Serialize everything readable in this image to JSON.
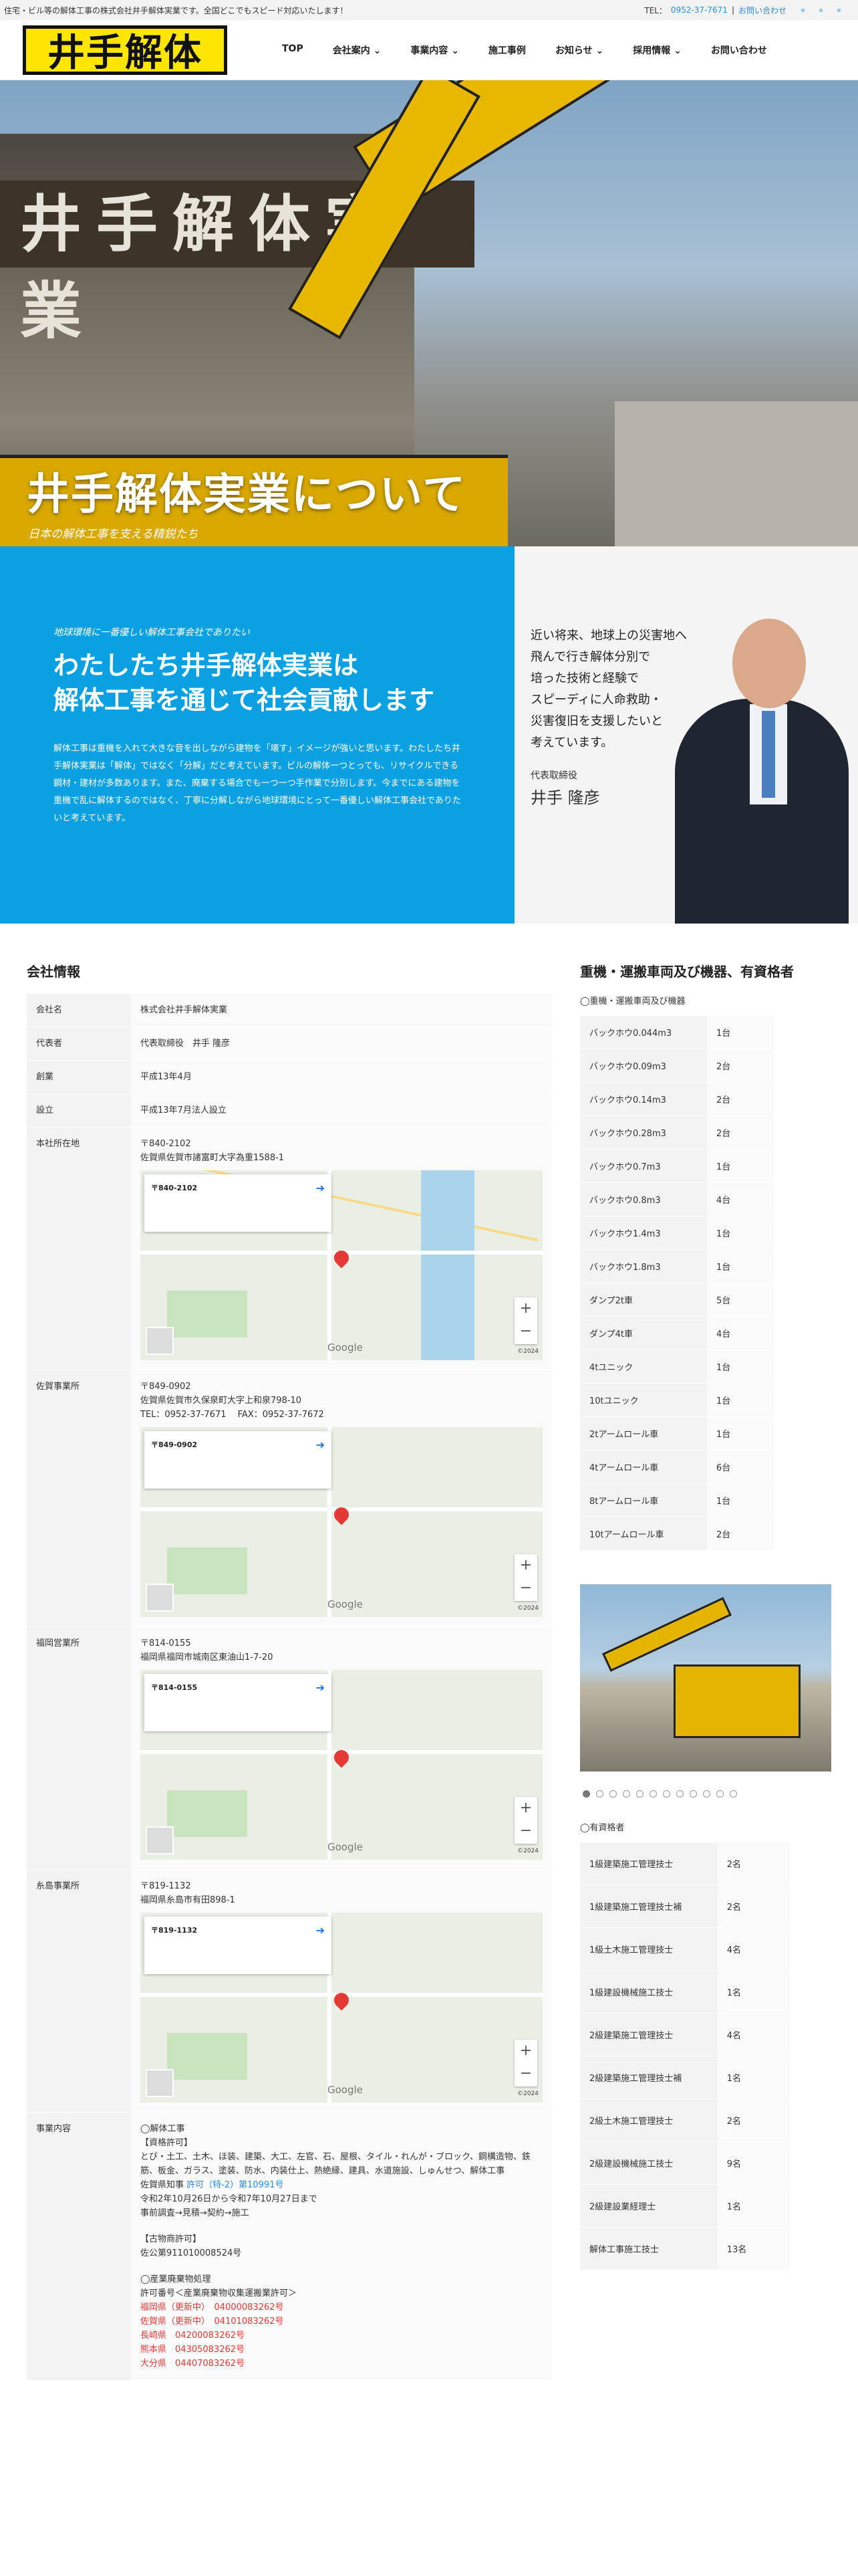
{
  "topbar": {
    "text": "住宅・ビル等の解体工事の株式会社井手解体実業です。全国どこでもスピード対応いたします！",
    "tel_label": "TEL：",
    "tel": "0952-37-7671",
    "sep": "|",
    "contact": "お問い合わせ"
  },
  "header": {
    "logo": "井手解体",
    "nav": [
      "TOP",
      "会社案内",
      "事業内容",
      "施工事例",
      "お知らせ",
      "採用情報",
      "お問い合わせ"
    ]
  },
  "hero": {
    "sign": "井手解体実業",
    "title": "井手解体実業について",
    "subtitle": "日本の解体工事を支える精鋭たち"
  },
  "about": {
    "tag": "地球環境に一番優しい解体工事会社でありたい",
    "headline1": "わたしたち井手解体実業は",
    "headline2": "解体工事を通じて社会貢献します",
    "body": "解体工事は重機を入れて大きな音を出しながら建物を「壊す」イメージが強いと思います。わたしたち井手解体実業は「解体」ではなく「分解」だと考えています。ビルの解体一つとっても、リサイクルできる鋼材・建材が多数あります。また、廃棄する場合でも一つ一つ手作業で分別します。今までにある建物を重機で乱に解体するのではなく、丁寧に分解しながら地球環境にとって一番優しい解体工事会社でありたいと考えています。",
    "message": [
      "近い将来、地球上の災害地へ",
      "飛んで行き解体分別で",
      "培った技術と経験で",
      "スピーディに人命救助・",
      "災害復旧を支援したいと",
      "考えています。"
    ],
    "role": "代表取締役",
    "name": "井手 隆彦"
  },
  "company": {
    "title": "会社情報",
    "rows": [
      {
        "k": "会社名",
        "v": "株式会社井手解体実業"
      },
      {
        "k": "代表者",
        "v": "代表取締役　井手 隆彦"
      },
      {
        "k": "創業",
        "v": "平成13年4月"
      },
      {
        "k": "設立",
        "v": "平成13年7月法人設立"
      }
    ],
    "hq": {
      "k": "本社所在地",
      "zip": "〒840-2102",
      "addr": "佐賀県佐賀市諸富町大字為重1588-1",
      "card": "〒840-2102"
    },
    "saga": {
      "k": "佐賀事業所",
      "zip": "〒849-0902",
      "addr": "佐賀県佐賀市久保泉町大字上和泉798-10",
      "tel": "TEL：0952-37-7671　 FAX：0952-37-7672",
      "card": "〒849-0902"
    },
    "fukuoka": {
      "k": "福岡営業所",
      "zip": "〒814-0155",
      "addr": "福岡県福岡市城南区東油山1-7-20",
      "card": "〒814-0155"
    },
    "itoshima": {
      "k": "糸島事業所",
      "zip": "〒819-1132",
      "addr": "福岡県糸島市有田898-1",
      "card": "〒819-1132"
    },
    "map_terms": "©2024",
    "business": {
      "k": "事業内容",
      "lines": [
        "◯解体工事",
        "【資格許可】",
        "とび・土工、土木、ほ装、建築、大工、左官、石、屋根、タイル・れんが・ブロック、鋼構造物、鉄筋、板金、ガラス、塗装、防水、内装仕上、熱絶縁、建具、水道施設、しゅんせつ、解体工事"
      ],
      "license_pre": "佐賀県知事",
      "license_link": "許可（特-2）第10991号",
      "license_dates": "令和2年10月26日から令和7年10月27日まで",
      "flow": "事前調査→見積→契約→施工",
      "antique_title": "【古物商許可】",
      "antique": "佐公第911010008524号",
      "waste_title": "◯産業廃棄物処理",
      "waste_sub": "許可番号＜産業廃棄物収集運搬業許可＞",
      "waste": [
        {
          "pref": "福岡県（更新中）",
          "no": "04000083262号"
        },
        {
          "pref": "佐賀県（更新中）",
          "no": "04101083262号"
        },
        {
          "pref": "長崎県",
          "no": "04200083262号"
        },
        {
          "pref": "熊本県",
          "no": "04305083262号"
        },
        {
          "pref": "大分県",
          "no": "04407083262号"
        }
      ]
    }
  },
  "machines": {
    "title": "重機・運搬車両及び機器、有資格者",
    "subtitle": "◯重機・運搬車両及び機器",
    "rows": [
      {
        "k": "バックホウ0.044m3",
        "v": "1台"
      },
      {
        "k": "バックホウ0.09m3",
        "v": "2台"
      },
      {
        "k": "バックホウ0.14m3",
        "v": "2台"
      },
      {
        "k": "バックホウ0.28m3",
        "v": "2台"
      },
      {
        "k": "バックホウ0.7m3",
        "v": "1台"
      },
      {
        "k": "バックホウ0.8m3",
        "v": "4台"
      },
      {
        "k": "バックホウ1.4m3",
        "v": "1台"
      },
      {
        "k": "バックホウ1.8m3",
        "v": "1台"
      },
      {
        "k": "ダンプ2t車",
        "v": "5台"
      },
      {
        "k": "ダンプ4t車",
        "v": "4台"
      },
      {
        "k": "4tユニック",
        "v": "1台"
      },
      {
        "k": "10tユニック",
        "v": "1台"
      },
      {
        "k": "2tアームロール車",
        "v": "1台"
      },
      {
        "k": "4tアームロール車",
        "v": "6台"
      },
      {
        "k": "8tアームロール車",
        "v": "1台"
      },
      {
        "k": "10tアームロール車",
        "v": "2台"
      }
    ],
    "slides": 12,
    "qual_subtitle": "◯有資格者",
    "quals": [
      {
        "k": "1級建築施工管理技士",
        "v": "2名"
      },
      {
        "k": "1級建築施工管理技士補",
        "v": "2名"
      },
      {
        "k": "1級土木施工管理技士",
        "v": "4名"
      },
      {
        "k": "1級建設機械施工技士",
        "v": "1名"
      },
      {
        "k": "2級建築施工管理技士",
        "v": "4名"
      },
      {
        "k": "2級建築施工管理技士補",
        "v": "1名"
      },
      {
        "k": "2級土木施工管理技士",
        "v": "2名"
      },
      {
        "k": "2級建設機械施工技士",
        "v": "9名"
      },
      {
        "k": "2級建設業経理士",
        "v": "1名"
      },
      {
        "k": "解体工事施工技士",
        "v": "13名"
      }
    ]
  }
}
